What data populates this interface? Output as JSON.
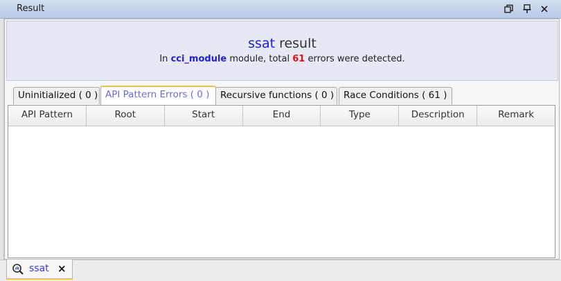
{
  "window": {
    "title": "Result"
  },
  "banner": {
    "tool": "ssat",
    "heading_suffix": "result",
    "summary_prefix": "In",
    "module_name": "cci_module",
    "summary_middle": "module, total",
    "error_count": "61",
    "summary_suffix": "errors were detected."
  },
  "tabs": [
    {
      "label": "Uninitialized ( 0 )"
    },
    {
      "label": "API Pattern Errors ( 0 )"
    },
    {
      "label": "Recursive functions ( 0 )"
    },
    {
      "label": "Race Conditions ( 61 )"
    }
  ],
  "active_tab": "API Pattern Errors ( 0 )",
  "table": {
    "columns": [
      "API Pattern",
      "Root",
      "Start",
      "End",
      "Type",
      "Description",
      "Remark"
    ],
    "rows": []
  },
  "bottom_tab": {
    "label": "ssat",
    "close": "×"
  },
  "colors": {
    "accent_tab": "#f0c040",
    "module": "#1d1ddb",
    "count": "#e01010",
    "active_tab_text": "#6a6ae0"
  }
}
